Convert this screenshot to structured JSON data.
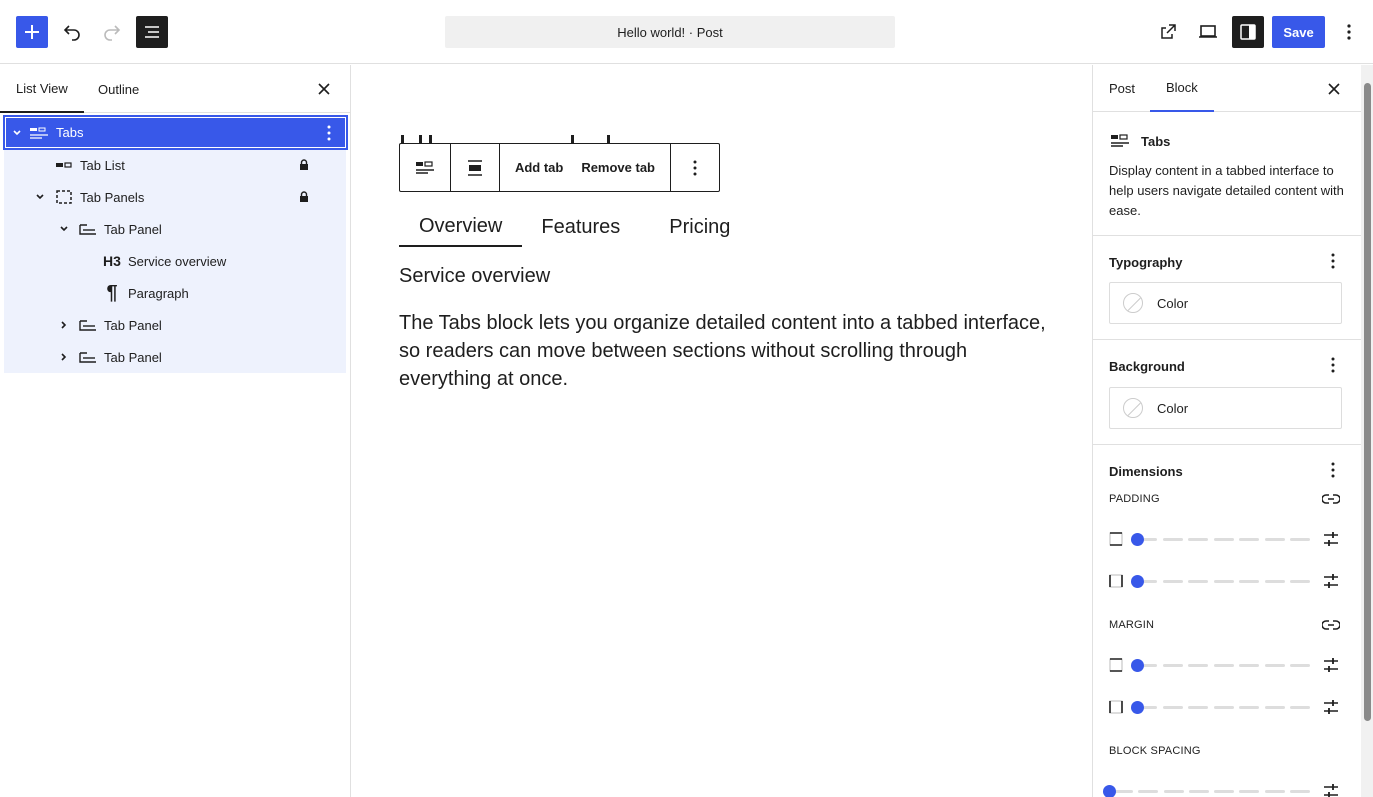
{
  "topbar": {
    "document_title": "Hello world! · Post",
    "save_label": "Save",
    "accent": "#3858e9"
  },
  "left_panel": {
    "tabs": [
      {
        "label": "List View",
        "active": true
      },
      {
        "label": "Outline",
        "active": false
      }
    ],
    "tree": [
      {
        "label": "Tabs",
        "icon": "tabs-icon",
        "level": 1,
        "expanded": true,
        "selected": true
      },
      {
        "label": "Tab List",
        "icon": "tab-list-icon",
        "level": 2,
        "locked": true
      },
      {
        "label": "Tab Panels",
        "icon": "tab-panels-icon",
        "level": 2,
        "expanded": true,
        "locked": true
      },
      {
        "label": "Tab Panel",
        "icon": "tab-panel-icon",
        "level": 3,
        "expanded": true
      },
      {
        "label": "Service overview",
        "icon": "heading-icon",
        "icon_text": "H3",
        "level": 4
      },
      {
        "label": "Paragraph",
        "icon": "paragraph-icon",
        "icon_text": "¶",
        "level": 4
      },
      {
        "label": "Tab Panel",
        "icon": "tab-panel-icon",
        "level": 3,
        "expanded": false
      },
      {
        "label": "Tab Panel",
        "icon": "tab-panel-icon",
        "level": 3,
        "expanded": false
      }
    ]
  },
  "canvas": {
    "toolbar": {
      "add_tab": "Add tab",
      "remove_tab": "Remove tab"
    },
    "tabs": [
      {
        "label": "Overview",
        "active": true
      },
      {
        "label": "Features",
        "active": false
      },
      {
        "label": "Pricing",
        "active": false
      }
    ],
    "heading": "Service overview",
    "paragraph": "The Tabs block lets you organize detailed content into a tabbed interface, so readers can move between sections without scrolling through everything at once."
  },
  "right_panel": {
    "tabs": [
      {
        "label": "Post",
        "active": false
      },
      {
        "label": "Block",
        "active": true
      }
    ],
    "block_card": {
      "title": "Tabs",
      "description": "Display content in a tabbed interface to help users navigate detailed content with ease."
    },
    "typography": {
      "title": "Typography",
      "color_label": "Color"
    },
    "background": {
      "title": "Background",
      "color_label": "Color"
    },
    "dimensions": {
      "title": "Dimensions",
      "padding_label": "PADDING",
      "margin_label": "MARGIN",
      "block_spacing_label": "BLOCK SPACING",
      "padding_values": [
        0,
        0
      ],
      "margin_values": [
        0,
        0
      ],
      "block_spacing_value": 0
    }
  }
}
